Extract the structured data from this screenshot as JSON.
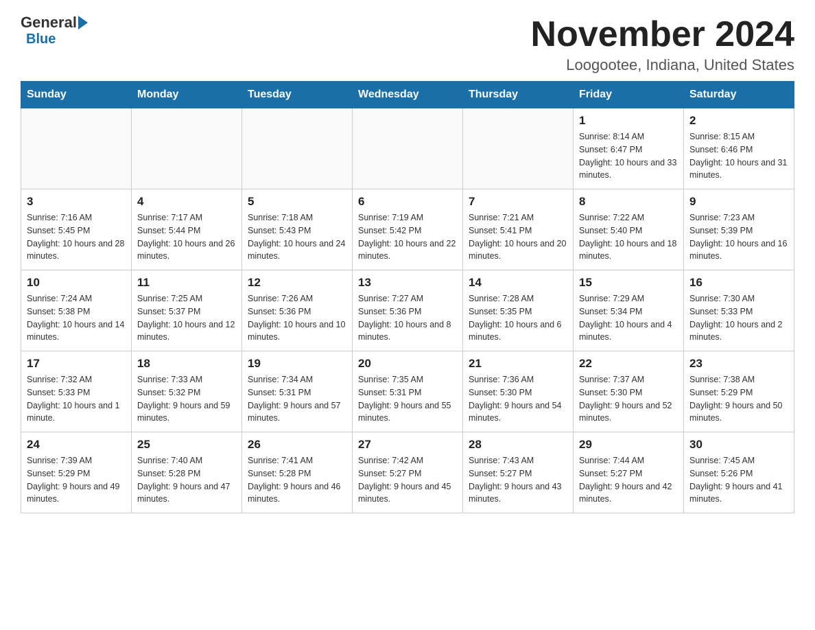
{
  "header": {
    "logo_general": "General",
    "logo_blue": "Blue",
    "month_title": "November 2024",
    "location": "Loogootee, Indiana, United States"
  },
  "weekdays": [
    "Sunday",
    "Monday",
    "Tuesday",
    "Wednesday",
    "Thursday",
    "Friday",
    "Saturday"
  ],
  "weeks": [
    [
      {
        "day": "",
        "sunrise": "",
        "sunset": "",
        "daylight": ""
      },
      {
        "day": "",
        "sunrise": "",
        "sunset": "",
        "daylight": ""
      },
      {
        "day": "",
        "sunrise": "",
        "sunset": "",
        "daylight": ""
      },
      {
        "day": "",
        "sunrise": "",
        "sunset": "",
        "daylight": ""
      },
      {
        "day": "",
        "sunrise": "",
        "sunset": "",
        "daylight": ""
      },
      {
        "day": "1",
        "sunrise": "Sunrise: 8:14 AM",
        "sunset": "Sunset: 6:47 PM",
        "daylight": "Daylight: 10 hours and 33 minutes."
      },
      {
        "day": "2",
        "sunrise": "Sunrise: 8:15 AM",
        "sunset": "Sunset: 6:46 PM",
        "daylight": "Daylight: 10 hours and 31 minutes."
      }
    ],
    [
      {
        "day": "3",
        "sunrise": "Sunrise: 7:16 AM",
        "sunset": "Sunset: 5:45 PM",
        "daylight": "Daylight: 10 hours and 28 minutes."
      },
      {
        "day": "4",
        "sunrise": "Sunrise: 7:17 AM",
        "sunset": "Sunset: 5:44 PM",
        "daylight": "Daylight: 10 hours and 26 minutes."
      },
      {
        "day": "5",
        "sunrise": "Sunrise: 7:18 AM",
        "sunset": "Sunset: 5:43 PM",
        "daylight": "Daylight: 10 hours and 24 minutes."
      },
      {
        "day": "6",
        "sunrise": "Sunrise: 7:19 AM",
        "sunset": "Sunset: 5:42 PM",
        "daylight": "Daylight: 10 hours and 22 minutes."
      },
      {
        "day": "7",
        "sunrise": "Sunrise: 7:21 AM",
        "sunset": "Sunset: 5:41 PM",
        "daylight": "Daylight: 10 hours and 20 minutes."
      },
      {
        "day": "8",
        "sunrise": "Sunrise: 7:22 AM",
        "sunset": "Sunset: 5:40 PM",
        "daylight": "Daylight: 10 hours and 18 minutes."
      },
      {
        "day": "9",
        "sunrise": "Sunrise: 7:23 AM",
        "sunset": "Sunset: 5:39 PM",
        "daylight": "Daylight: 10 hours and 16 minutes."
      }
    ],
    [
      {
        "day": "10",
        "sunrise": "Sunrise: 7:24 AM",
        "sunset": "Sunset: 5:38 PM",
        "daylight": "Daylight: 10 hours and 14 minutes."
      },
      {
        "day": "11",
        "sunrise": "Sunrise: 7:25 AM",
        "sunset": "Sunset: 5:37 PM",
        "daylight": "Daylight: 10 hours and 12 minutes."
      },
      {
        "day": "12",
        "sunrise": "Sunrise: 7:26 AM",
        "sunset": "Sunset: 5:36 PM",
        "daylight": "Daylight: 10 hours and 10 minutes."
      },
      {
        "day": "13",
        "sunrise": "Sunrise: 7:27 AM",
        "sunset": "Sunset: 5:36 PM",
        "daylight": "Daylight: 10 hours and 8 minutes."
      },
      {
        "day": "14",
        "sunrise": "Sunrise: 7:28 AM",
        "sunset": "Sunset: 5:35 PM",
        "daylight": "Daylight: 10 hours and 6 minutes."
      },
      {
        "day": "15",
        "sunrise": "Sunrise: 7:29 AM",
        "sunset": "Sunset: 5:34 PM",
        "daylight": "Daylight: 10 hours and 4 minutes."
      },
      {
        "day": "16",
        "sunrise": "Sunrise: 7:30 AM",
        "sunset": "Sunset: 5:33 PM",
        "daylight": "Daylight: 10 hours and 2 minutes."
      }
    ],
    [
      {
        "day": "17",
        "sunrise": "Sunrise: 7:32 AM",
        "sunset": "Sunset: 5:33 PM",
        "daylight": "Daylight: 10 hours and 1 minute."
      },
      {
        "day": "18",
        "sunrise": "Sunrise: 7:33 AM",
        "sunset": "Sunset: 5:32 PM",
        "daylight": "Daylight: 9 hours and 59 minutes."
      },
      {
        "day": "19",
        "sunrise": "Sunrise: 7:34 AM",
        "sunset": "Sunset: 5:31 PM",
        "daylight": "Daylight: 9 hours and 57 minutes."
      },
      {
        "day": "20",
        "sunrise": "Sunrise: 7:35 AM",
        "sunset": "Sunset: 5:31 PM",
        "daylight": "Daylight: 9 hours and 55 minutes."
      },
      {
        "day": "21",
        "sunrise": "Sunrise: 7:36 AM",
        "sunset": "Sunset: 5:30 PM",
        "daylight": "Daylight: 9 hours and 54 minutes."
      },
      {
        "day": "22",
        "sunrise": "Sunrise: 7:37 AM",
        "sunset": "Sunset: 5:30 PM",
        "daylight": "Daylight: 9 hours and 52 minutes."
      },
      {
        "day": "23",
        "sunrise": "Sunrise: 7:38 AM",
        "sunset": "Sunset: 5:29 PM",
        "daylight": "Daylight: 9 hours and 50 minutes."
      }
    ],
    [
      {
        "day": "24",
        "sunrise": "Sunrise: 7:39 AM",
        "sunset": "Sunset: 5:29 PM",
        "daylight": "Daylight: 9 hours and 49 minutes."
      },
      {
        "day": "25",
        "sunrise": "Sunrise: 7:40 AM",
        "sunset": "Sunset: 5:28 PM",
        "daylight": "Daylight: 9 hours and 47 minutes."
      },
      {
        "day": "26",
        "sunrise": "Sunrise: 7:41 AM",
        "sunset": "Sunset: 5:28 PM",
        "daylight": "Daylight: 9 hours and 46 minutes."
      },
      {
        "day": "27",
        "sunrise": "Sunrise: 7:42 AM",
        "sunset": "Sunset: 5:27 PM",
        "daylight": "Daylight: 9 hours and 45 minutes."
      },
      {
        "day": "28",
        "sunrise": "Sunrise: 7:43 AM",
        "sunset": "Sunset: 5:27 PM",
        "daylight": "Daylight: 9 hours and 43 minutes."
      },
      {
        "day": "29",
        "sunrise": "Sunrise: 7:44 AM",
        "sunset": "Sunset: 5:27 PM",
        "daylight": "Daylight: 9 hours and 42 minutes."
      },
      {
        "day": "30",
        "sunrise": "Sunrise: 7:45 AM",
        "sunset": "Sunset: 5:26 PM",
        "daylight": "Daylight: 9 hours and 41 minutes."
      }
    ]
  ]
}
